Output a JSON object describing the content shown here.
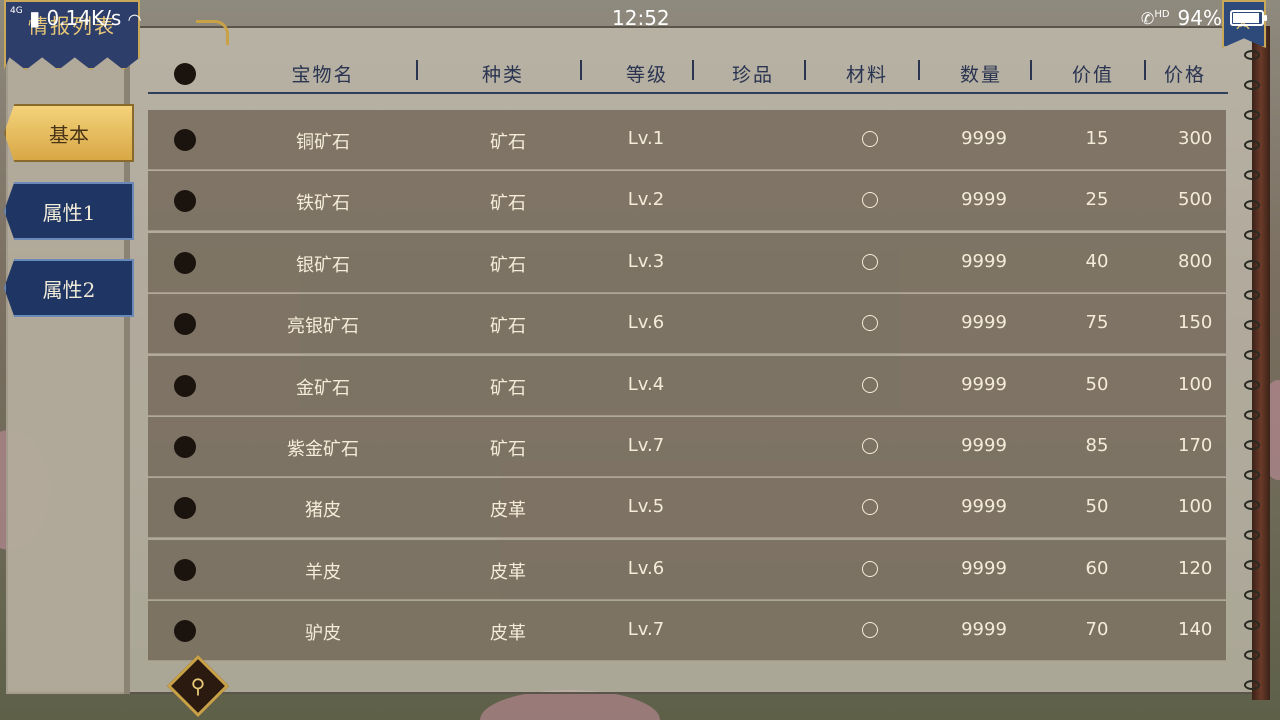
{
  "status_bar": {
    "network": "4G",
    "speed": "0.14K/s",
    "time": "12:52",
    "call_label": "HD",
    "battery": "94%",
    "battery_level": 0.94
  },
  "title": "情报列表",
  "tabs": [
    {
      "label": "基本",
      "active": true
    },
    {
      "label": "属性1",
      "active": false
    },
    {
      "label": "属性2",
      "active": false
    }
  ],
  "table": {
    "columns": [
      "宝物名",
      "种类",
      "等级",
      "珍品",
      "材料",
      "数量",
      "价值",
      "价格"
    ],
    "rows": [
      {
        "name": "铜矿石",
        "type": "矿石",
        "level": "Lv.1",
        "material": true,
        "qty": "9999",
        "value": "15",
        "price": "300"
      },
      {
        "name": "铁矿石",
        "type": "矿石",
        "level": "Lv.2",
        "material": true,
        "qty": "9999",
        "value": "25",
        "price": "500"
      },
      {
        "name": "银矿石",
        "type": "矿石",
        "level": "Lv.3",
        "material": true,
        "qty": "9999",
        "value": "40",
        "price": "800"
      },
      {
        "name": "亮银矿石",
        "type": "矿石",
        "level": "Lv.6",
        "material": true,
        "qty": "9999",
        "value": "75",
        "price": "150"
      },
      {
        "name": "金矿石",
        "type": "矿石",
        "level": "Lv.4",
        "material": true,
        "qty": "9999",
        "value": "50",
        "price": "100"
      },
      {
        "name": "紫金矿石",
        "type": "矿石",
        "level": "Lv.7",
        "material": true,
        "qty": "9999",
        "value": "85",
        "price": "170"
      },
      {
        "name": "猪皮",
        "type": "皮革",
        "level": "Lv.5",
        "material": true,
        "qty": "9999",
        "value": "50",
        "price": "100"
      },
      {
        "name": "羊皮",
        "type": "皮革",
        "level": "Lv.6",
        "material": true,
        "qty": "9999",
        "value": "60",
        "price": "120"
      },
      {
        "name": "驴皮",
        "type": "皮革",
        "level": "Lv.7",
        "material": true,
        "qty": "9999",
        "value": "70",
        "price": "140"
      }
    ]
  },
  "icons": {
    "search": "magnifier-icon",
    "ribbon": "crossed-swords-icon"
  },
  "colors": {
    "tab_active": "#e8c060",
    "tab_inactive": "#1f3563",
    "row_bg": "#706454",
    "accent_gold": "#c9a248"
  }
}
